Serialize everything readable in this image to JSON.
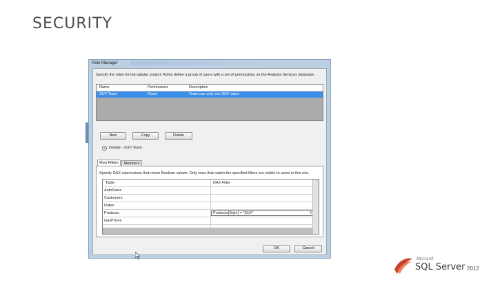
{
  "slide": {
    "title": "SECURITY"
  },
  "dialog": {
    "title": "Role Manager",
    "description": "Specify the roles for the tabular project. Roles define a group of users with a set of permissions on the Analysis Services database.",
    "roles_columns": [
      "Name",
      "Permissions",
      "Description"
    ],
    "roles_rows": [
      {
        "name": "SUV Team",
        "permissions": "Read",
        "description": "Team can only see SUV sales"
      }
    ],
    "buttons": {
      "new": "New",
      "copy": "Copy",
      "delete": "Delete",
      "ok": "OK",
      "cancel": "Cancel"
    },
    "details_label": "Details - SUV Team",
    "tabs": [
      "Row Filters",
      "Members"
    ],
    "row_filters_desc": "Specify DAX expressions that return Boolean values. Only rows that match the specified filters are visible to users in this role.",
    "filter_columns": [
      "Table",
      "DAX Filter"
    ],
    "filter_rows": [
      {
        "table": "AutoSales",
        "dax": ""
      },
      {
        "table": "Customers",
        "dax": ""
      },
      {
        "table": "Dates",
        "dax": ""
      },
      {
        "table": "Products",
        "dax": "Products[Style] = \"SUV\""
      },
      {
        "table": "GasPrices",
        "dax": ""
      }
    ]
  },
  "logo": {
    "company": "Microsoft",
    "product": "SQL Server",
    "year": "2012"
  },
  "colors": {
    "selection": "#3d8ee6",
    "window_frame": "#bcd0e4"
  }
}
